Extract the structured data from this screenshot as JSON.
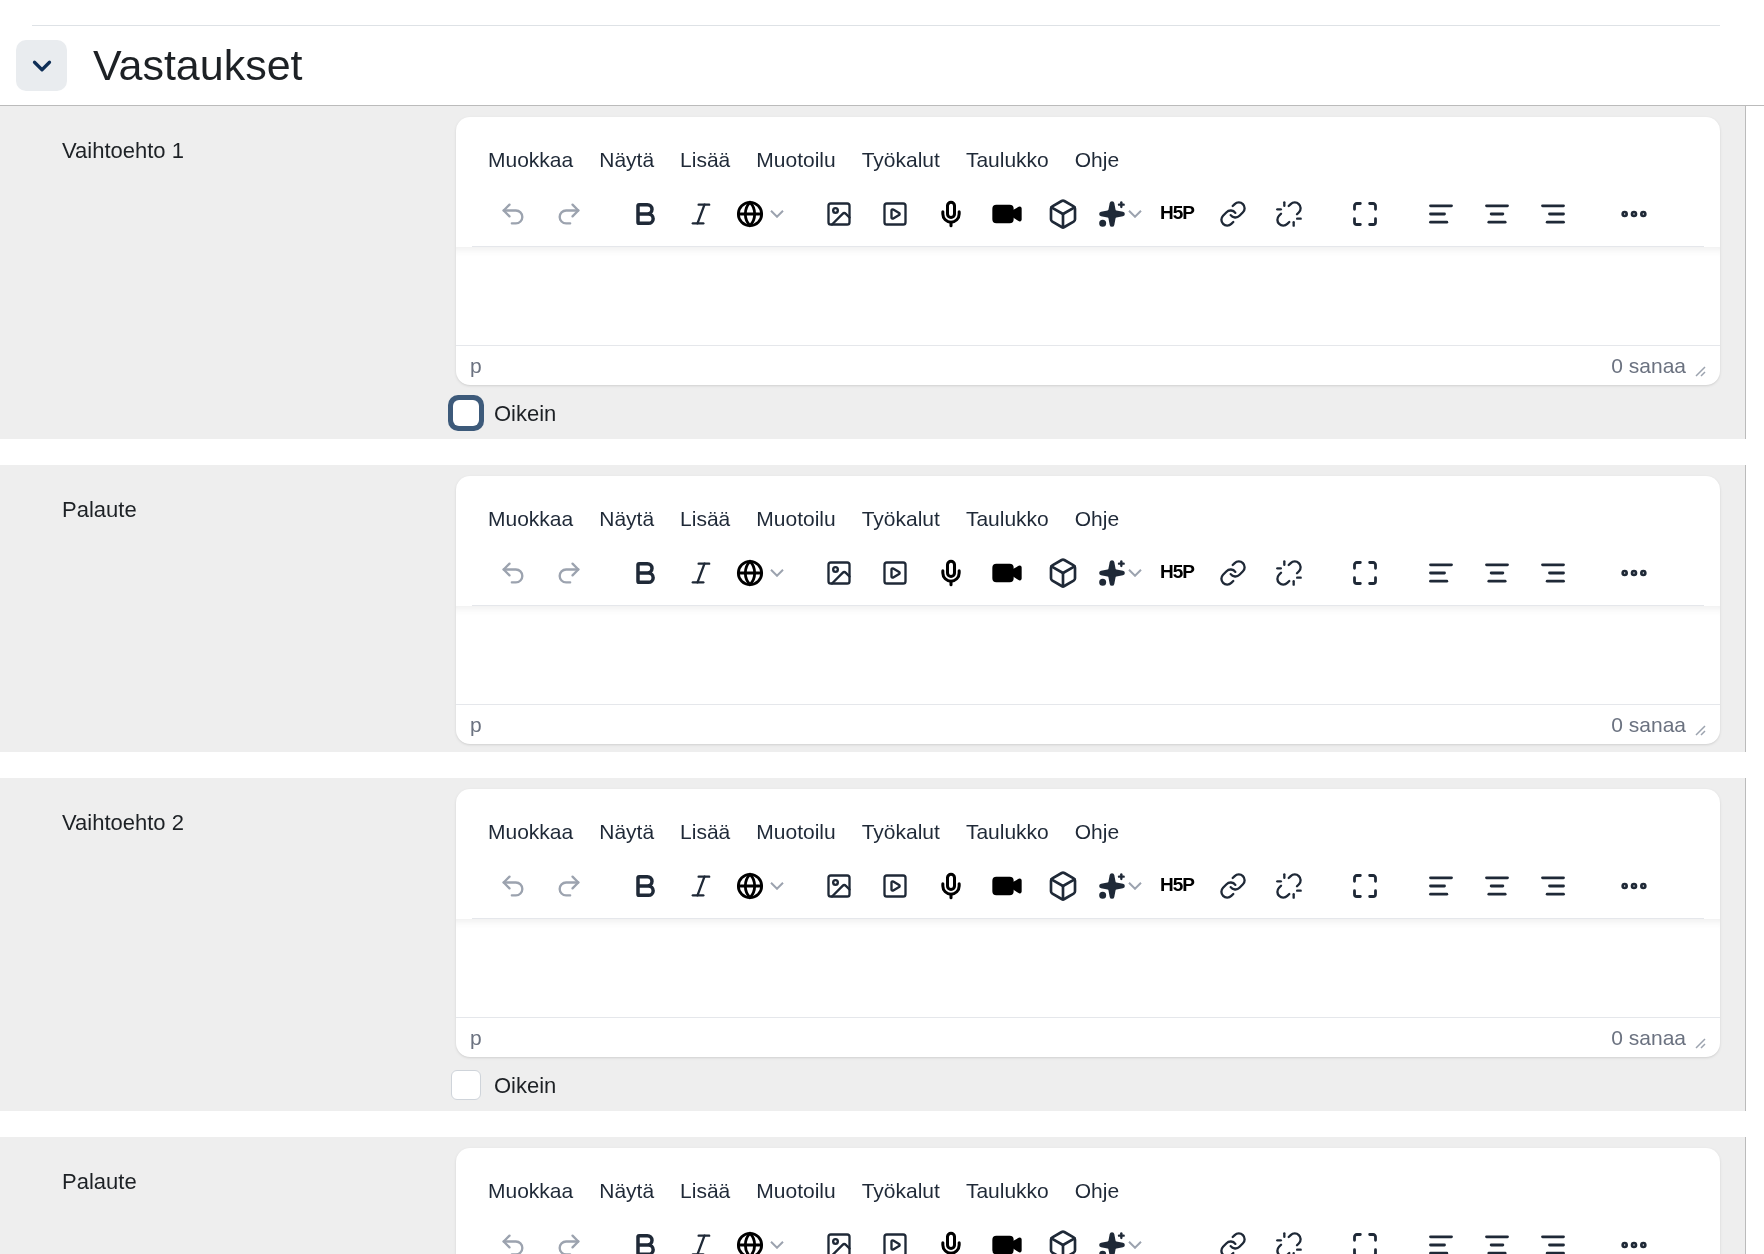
{
  "section": {
    "title": "Vastaukset",
    "expanded": true
  },
  "fields": [
    {
      "label": "Vaihtoehto 1",
      "editor": {
        "menu": [
          "Muokkaa",
          "Näytä",
          "Lisää",
          "Muotoilu",
          "Työkalut",
          "Taulukko",
          "Ohje"
        ],
        "h5p": "H5P",
        "path": "p",
        "word_count": "0 sanaa"
      },
      "checkbox": {
        "label": "Oikein",
        "checked": false,
        "focused": true
      }
    },
    {
      "label": "Palaute",
      "editor": {
        "menu": [
          "Muokkaa",
          "Näytä",
          "Lisää",
          "Muotoilu",
          "Työkalut",
          "Taulukko",
          "Ohje"
        ],
        "h5p": "H5P",
        "path": "p",
        "word_count": "0 sanaa"
      }
    },
    {
      "label": "Vaihtoehto 2",
      "editor": {
        "menu": [
          "Muokkaa",
          "Näytä",
          "Lisää",
          "Muotoilu",
          "Työkalut",
          "Taulukko",
          "Ohje"
        ],
        "h5p": "H5P",
        "path": "p",
        "word_count": "0 sanaa"
      },
      "checkbox": {
        "label": "Oikein",
        "checked": false,
        "focused": false
      }
    },
    {
      "label": "Palaute",
      "editor": {
        "menu": [
          "Muokkaa",
          "Näytä",
          "Lisää",
          "Muotoilu",
          "Työkalut",
          "Taulukko",
          "Ohje"
        ]
      }
    }
  ]
}
